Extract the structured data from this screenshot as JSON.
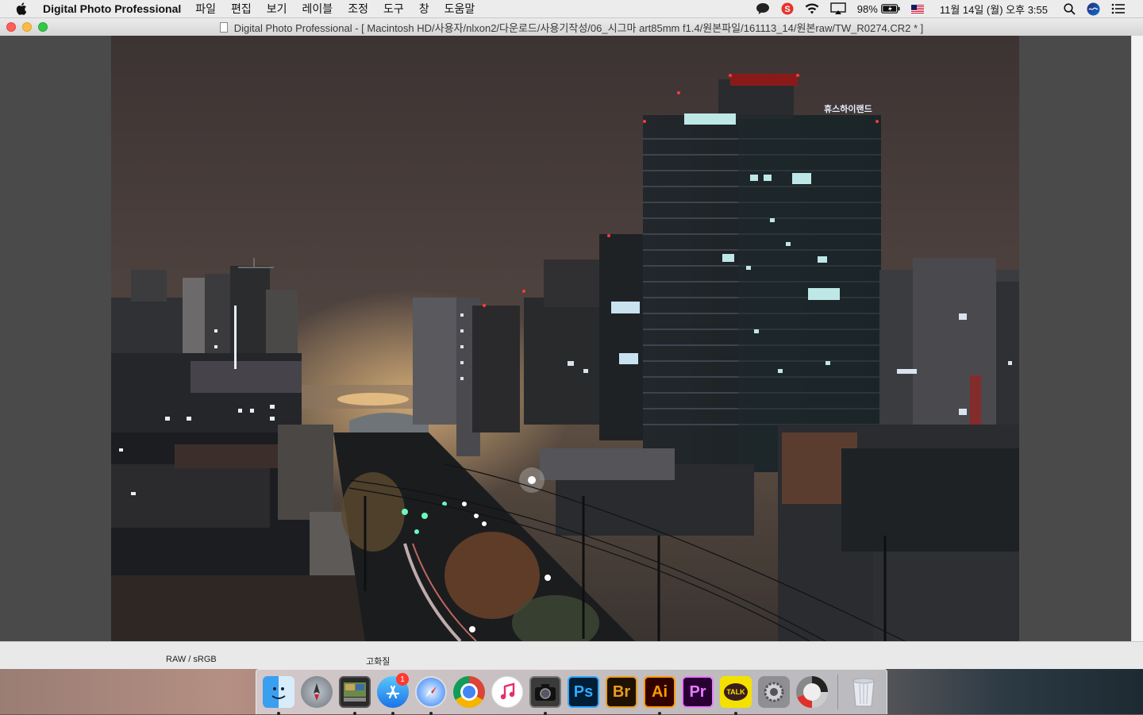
{
  "menubar": {
    "app_name": "Digital Photo Professional",
    "menus": [
      "파일",
      "편집",
      "보기",
      "레이블",
      "조정",
      "도구",
      "창",
      "도움말"
    ],
    "battery": "98%",
    "datetime": "11월 14일 (월) 오후 3:55"
  },
  "window": {
    "title": "Digital Photo Professional - [ Macintosh HD/사용자/nlxon2/다운로드/사용기작성/06_시그마 art85mm f1.4/원본파일/161113_14/원본raw/TW_R0274.CR2 * ]"
  },
  "photo": {
    "building_sign": "휴스하이랜드"
  },
  "statusbar": {
    "color_info": "RAW / sRGB",
    "quality": "고화질"
  },
  "dock": {
    "items": [
      {
        "name": "Finder",
        "icon": "finder-icon",
        "running": true
      },
      {
        "name": "Launchpad",
        "icon": "launchpad-icon",
        "running": false
      },
      {
        "name": "Digital Photo Professional",
        "icon": "dpp-icon",
        "running": true
      },
      {
        "name": "App Store",
        "icon": "app-store-icon",
        "badge": "1",
        "running": true
      },
      {
        "name": "Safari",
        "icon": "safari-icon",
        "running": true
      },
      {
        "name": "Chrome",
        "icon": "chrome-icon",
        "running": false
      },
      {
        "name": "iTunes",
        "icon": "itunes-icon",
        "running": false
      },
      {
        "name": "Image Capture",
        "icon": "camera-icon",
        "running": true
      },
      {
        "name": "Ps",
        "icon": "photoshop-icon",
        "running": false
      },
      {
        "name": "Br",
        "icon": "bridge-icon",
        "running": false
      },
      {
        "name": "Ai",
        "icon": "illustrator-icon",
        "running": true
      },
      {
        "name": "Pr",
        "icon": "premiere-icon",
        "running": false
      },
      {
        "name": "TALK",
        "icon": "kakaotalk-icon",
        "running": true
      },
      {
        "name": "System Preferences",
        "icon": "system-preferences-icon",
        "running": false
      },
      {
        "name": "Disk Utility",
        "icon": "disk-utility-icon",
        "running": false
      },
      {
        "name": "Trash",
        "icon": "trash-icon",
        "running": false
      }
    ]
  },
  "colors": {
    "ps": "#001e36",
    "ps_text": "#31a8ff",
    "br": "#1f1100",
    "br_text": "#e89c22",
    "ai": "#330000",
    "ai_text": "#ff9a00",
    "pr": "#2a0034",
    "pr_text": "#e77cff",
    "talk": "#f5e100"
  }
}
